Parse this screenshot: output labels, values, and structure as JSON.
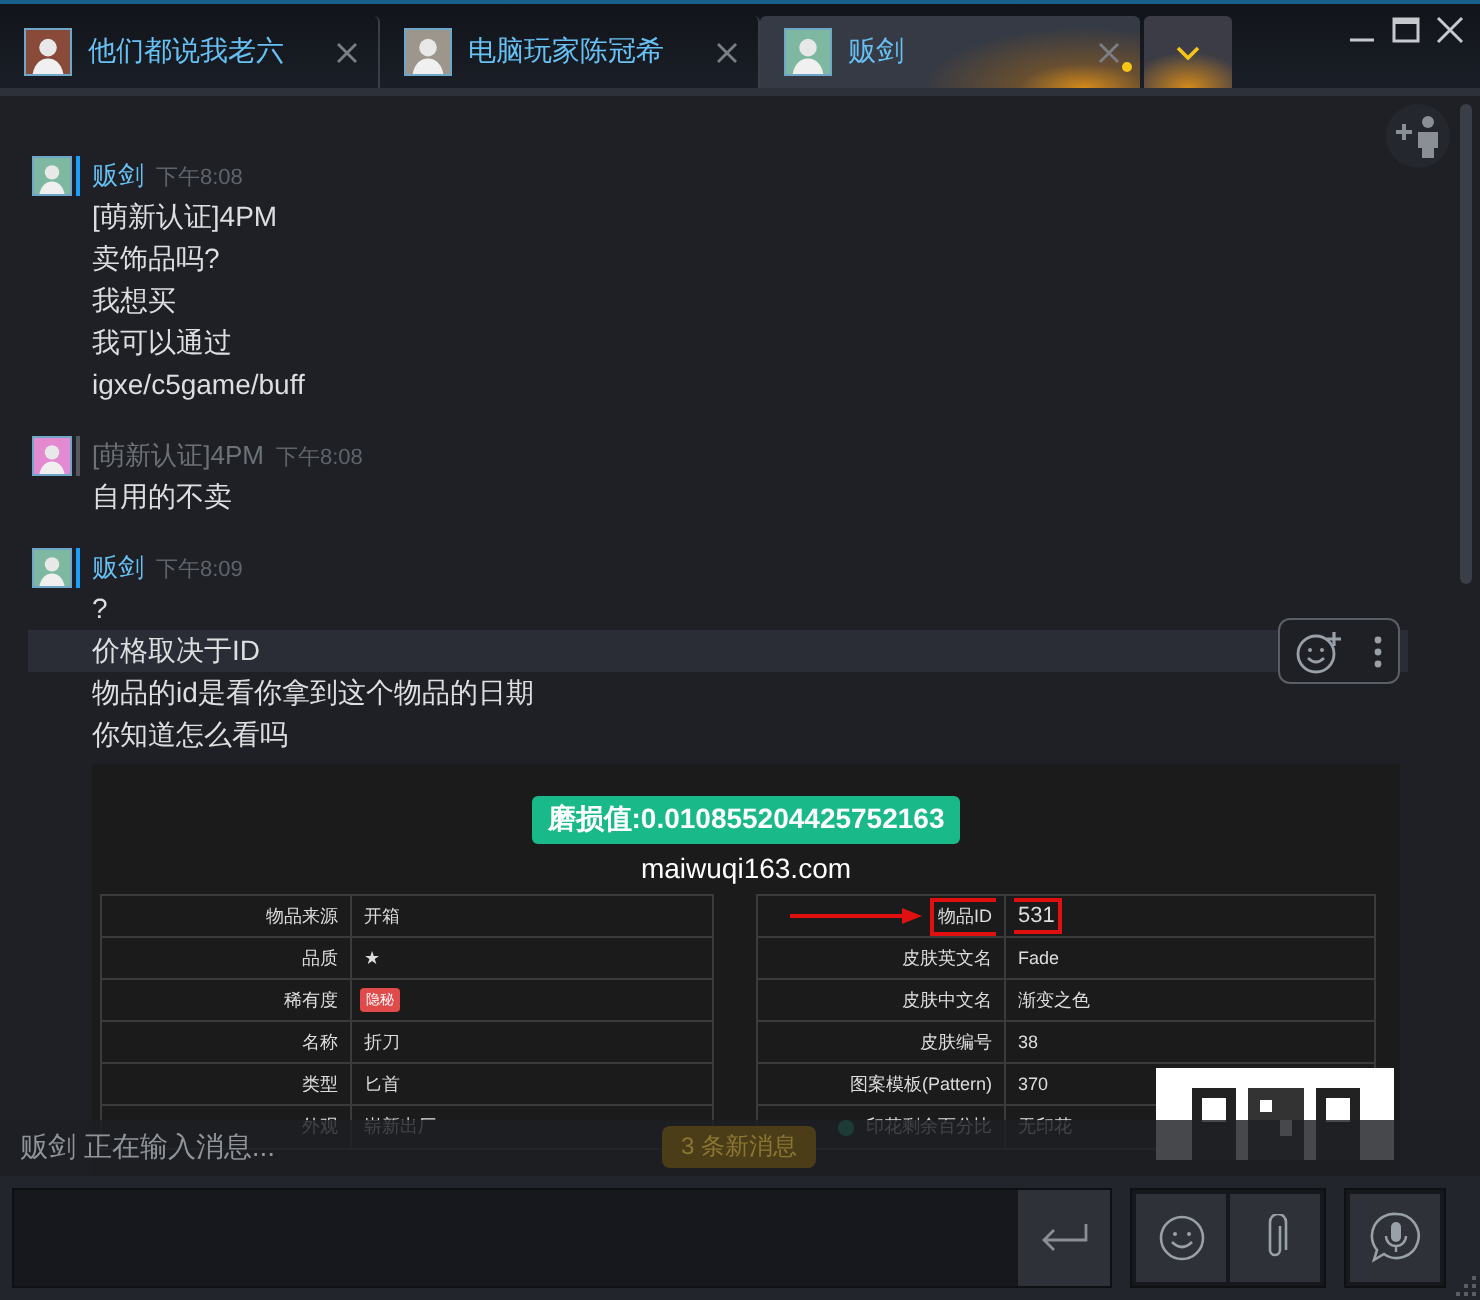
{
  "tabs": [
    {
      "title": "他们都说我老六",
      "selected": false,
      "unread": false
    },
    {
      "title": "电脑玩家陈冠希",
      "selected": false,
      "unread": false
    },
    {
      "title": "贩剑",
      "selected": true,
      "unread": true
    }
  ],
  "messages": [
    {
      "sender": "贩剑",
      "time": "下午8:08",
      "kind": "friend",
      "lines": [
        {
          "text": "[萌新认证]4PM",
          "highlighted": false
        },
        {
          "text": "卖饰品吗?",
          "highlighted": false
        },
        {
          "text": "我想买",
          "highlighted": false
        },
        {
          "text": "我可以通过",
          "highlighted": false
        },
        {
          "text": "igxe/c5game/buff",
          "highlighted": false
        }
      ]
    },
    {
      "sender": "[萌新认证]4PM",
      "time": "下午8:08",
      "kind": "self",
      "lines": [
        {
          "text": "自用的不卖",
          "highlighted": false
        }
      ]
    },
    {
      "sender": "贩剑",
      "time": "下午8:09",
      "kind": "friend",
      "lines": [
        {
          "text": "?",
          "highlighted": false
        },
        {
          "text": "价格取决于ID",
          "highlighted": true
        },
        {
          "text": "物品的id是看你拿到这个物品的日期",
          "highlighted": false
        },
        {
          "text": "你知道怎么看吗",
          "highlighted": false
        }
      ],
      "screenshot": {
        "badge": "磨损值:0.010855204425752163",
        "site": "maiwuqi163.com",
        "left_rows": [
          {
            "label": "物品来源",
            "value": "开箱",
            "kind": "plain"
          },
          {
            "label": "品质",
            "value": "★",
            "kind": "plain"
          },
          {
            "label": "稀有度",
            "value": "隐秘",
            "kind": "tag"
          },
          {
            "label": "名称",
            "value": "折刀",
            "kind": "plain"
          },
          {
            "label": "类型",
            "value": "匕首",
            "kind": "plain"
          },
          {
            "label": "外观",
            "value": "崭新出厂",
            "kind": "plain"
          }
        ],
        "right_rows": [
          {
            "label": "物品ID",
            "value": "531",
            "kind": "plain",
            "highlighted": true
          },
          {
            "label": "皮肤英文名",
            "value": "Fade",
            "kind": "plain",
            "highlighted": false
          },
          {
            "label": "皮肤中文名",
            "value": "渐变之色",
            "kind": "plain",
            "highlighted": false
          },
          {
            "label": "皮肤编号",
            "value": "38",
            "kind": "plain",
            "highlighted": false
          },
          {
            "label": "图案模板(Pattern)",
            "value": "370",
            "kind": "plain",
            "highlighted": false
          },
          {
            "label": "印花剩余百分比",
            "value": "无印花",
            "kind": "help",
            "highlighted": false
          }
        ]
      }
    }
  ],
  "typing_indicator": "贩剑 正在输入消息...",
  "new_messages_button": "3 条新消息"
}
